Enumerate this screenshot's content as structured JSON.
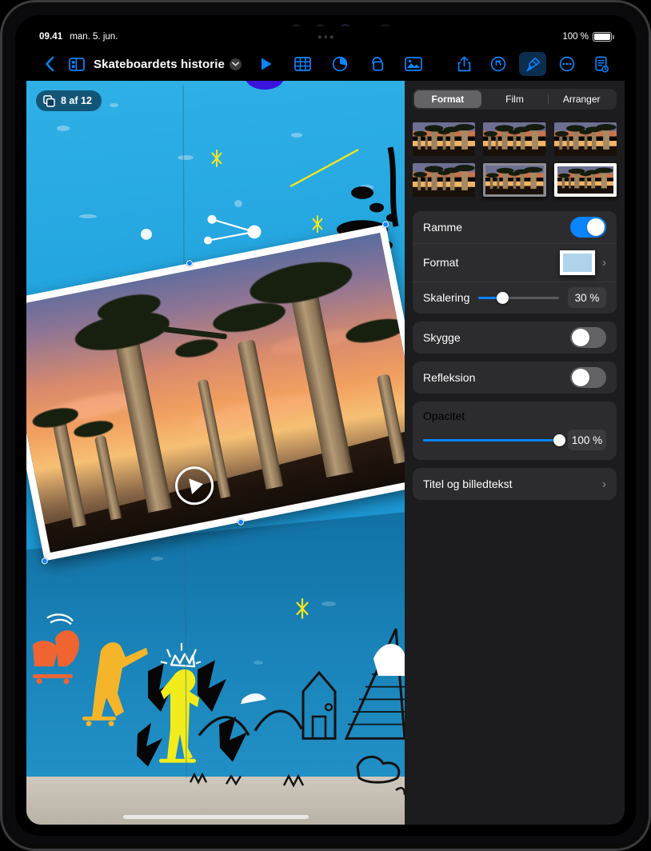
{
  "status_bar": {
    "time": "09.41",
    "date": "man. 5. jun.",
    "battery_percent": "100 %",
    "multitask_icon": "three-dots-icon"
  },
  "toolbar": {
    "back_icon": "chevron-left-icon",
    "navigator_icon": "sidebar-panel-icon",
    "document_title": "Skateboardets historie",
    "title_chevron_icon": "chevron-down-icon",
    "play_icon": "play-icon",
    "table_icon": "table-icon",
    "chart_icon": "pie-chart-icon",
    "shape_icon": "shapes-icon",
    "media_icon": "media-image-icon",
    "share_icon": "share-up-arrow-icon",
    "undo_icon": "undo-arrow-icon",
    "format_icon": "paintbrush-icon",
    "more_icon": "more-ellipsis-icon",
    "document_options_icon": "document-history-icon",
    "format_active": true
  },
  "canvas": {
    "slide_badge": {
      "icon": "slides-stack-icon",
      "text": "8 af 12"
    },
    "selected_object": {
      "type": "video",
      "play_overlay_icon": "play-circle-icon",
      "rotation_degrees": -11.2,
      "frame_color": "#ffffff",
      "handle_color": "#0a84ff"
    },
    "home_indicator": "home-indicator-bar"
  },
  "inspector": {
    "tabs": [
      {
        "label": "Format",
        "active": true
      },
      {
        "label": "Film",
        "active": false
      },
      {
        "label": "Arranger",
        "active": false
      }
    ],
    "styles": [
      {
        "name": "style-1",
        "selected": false,
        "frame": "none",
        "shadow": false
      },
      {
        "name": "style-2",
        "selected": false,
        "frame": "none",
        "shadow": false
      },
      {
        "name": "style-3",
        "selected": false,
        "frame": "none",
        "shadow": false
      },
      {
        "name": "style-4",
        "selected": false,
        "frame": "none",
        "shadow": false
      },
      {
        "name": "style-5",
        "selected": false,
        "frame": "gray",
        "shadow": true
      },
      {
        "name": "style-6",
        "selected": true,
        "frame": "white",
        "shadow": true
      }
    ],
    "frame": {
      "label": "Ramme",
      "enabled": true
    },
    "format": {
      "label": "Format",
      "preview_fill": "#aed3ea",
      "preview_border": "#ffffff",
      "chevron_icon": "chevron-right-icon"
    },
    "scaling": {
      "label": "Skalering",
      "value": "30 %",
      "percent": 30
    },
    "shadow": {
      "label": "Skygge",
      "enabled": false
    },
    "reflection": {
      "label": "Refleksion",
      "enabled": false
    },
    "opacity": {
      "label": "Opacitet",
      "value": "100 %",
      "percent": 100
    },
    "title_caption": {
      "label": "Titel og billedtekst",
      "chevron_icon": "chevron-right-icon"
    }
  },
  "colors": {
    "accent": "#0a84ff",
    "panel_bg": "#1c1c1e",
    "group_bg": "#2c2c2e",
    "canvas_blue": "#29a8e0"
  }
}
